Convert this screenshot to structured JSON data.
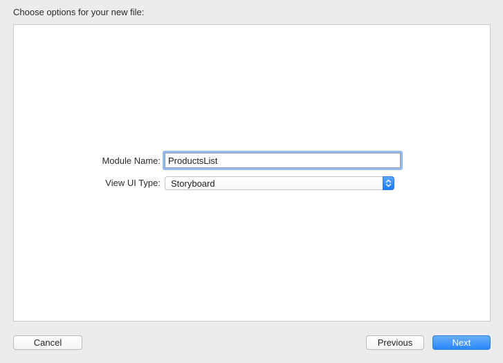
{
  "header": {
    "title": "Choose options for your new file:"
  },
  "form": {
    "module_name": {
      "label": "Module Name:",
      "value": "ProductsList"
    },
    "view_ui_type": {
      "label": "View UI Type:",
      "selected": "Storyboard"
    }
  },
  "footer": {
    "cancel_label": "Cancel",
    "previous_label": "Previous",
    "next_label": "Next"
  },
  "colors": {
    "window_background": "#ececec",
    "panel_background": "#ffffff",
    "accent": "#1a7bf5",
    "focus_ring": "#6ea5eb"
  }
}
